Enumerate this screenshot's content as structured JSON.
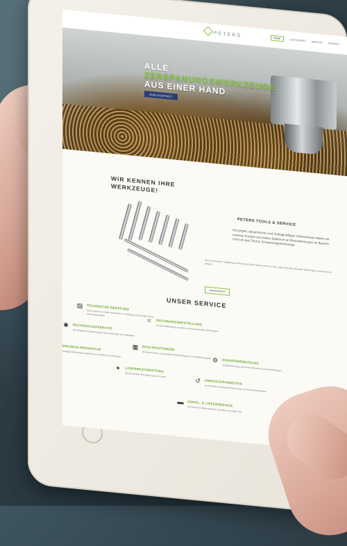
{
  "site": {
    "logo": "PETERS",
    "nav": [
      "HOME",
      "LEISTUNGEN",
      "SERVICE",
      "KONTAKT"
    ]
  },
  "hero": {
    "line1": "ALLE",
    "line2": "ZERSPANUNGSWERKZEUGE",
    "line3": "AUS EINER HAND",
    "button": "ZUM KONTAKT"
  },
  "about": {
    "title_line1": "WIR KENNEN IHRE",
    "title_line2": "WERKZEUGE!",
    "company": "PETERS TOOLS & SERVICE",
    "text": "Als junges, dynamisches und Schlagkräftiges Unternehmen bieten wir unseren Kunden ein breites Spektrum an Dienstleistungen im Bereich rund um das Thema Zerspanungswerkzeuge.",
    "small": "Auf Grund unserer langjährigen Erfahrung auf dem Gebiet, sind wir in der Lage Ihnen die passenden Werkzeuge zu liefern und zu pflegen.",
    "button": "ZUM KONTAKT"
  },
  "services": {
    "title": "UNSER SERVICE",
    "items": [
      {
        "icon": "chat-icon",
        "glyph": "▤",
        "title": "TECHNISCHE BERATUNG",
        "text": "Gerne stehen wir Ihnen persönlich zur Verfügung und beraten Sie zu Ihren Werkzeugen."
      },
      {
        "icon": "crop-icon",
        "glyph": "⌗",
        "title": "ZEICHNUNGSERSTELLUNG",
        "text": "Zu Ihren Werkzeugen erstellen wir die passenden Zeichnungen."
      },
      {
        "icon": "gear-icon",
        "glyph": "✱",
        "title": "NACHSCHLEIFSERVICE",
        "text": "Wir schleifen Ihre Werkzeuge nach und bringen sie in Bestform."
      },
      {
        "icon": "layers-icon",
        "glyph": "▦",
        "title": "BESCHICHTUNGEN",
        "text": "Wir bieten Ihnen verschiedene Beschichtungen für Ihre Werkzeuge an."
      },
      {
        "icon": "settings-icon",
        "glyph": "⚙",
        "title": "SONDERWERKZEUGE",
        "text": "Sonderwerkzeuge nach Ihren Wünschen und Anforderungen."
      },
      {
        "icon": "wrench-icon",
        "glyph": "✎",
        "title": "WERKZEUG-REPARATUR",
        "text": "Beschädigte Werkzeuge reparieren wir schnell und zuverlässig."
      },
      {
        "icon": "sparkle-icon",
        "glyph": "✦",
        "title": "LASERBESCHRIFTUNG",
        "text": "Wir beschriften Ihre Werkzeuge per Laser."
      },
      {
        "icon": "undo-icon",
        "glyph": "↺",
        "title": "UMSCHLEIFARBEITEN",
        "text": "Umschleifen vorhandener Werkzeuge auf neue Anforderungen."
      },
      {
        "icon": "truck-icon",
        "glyph": "▬",
        "title": "ABHOL- & LIEFERSERVICE",
        "text": "Wir holen Ihre Werkzeuge ab und liefern sie wieder aus."
      }
    ]
  }
}
